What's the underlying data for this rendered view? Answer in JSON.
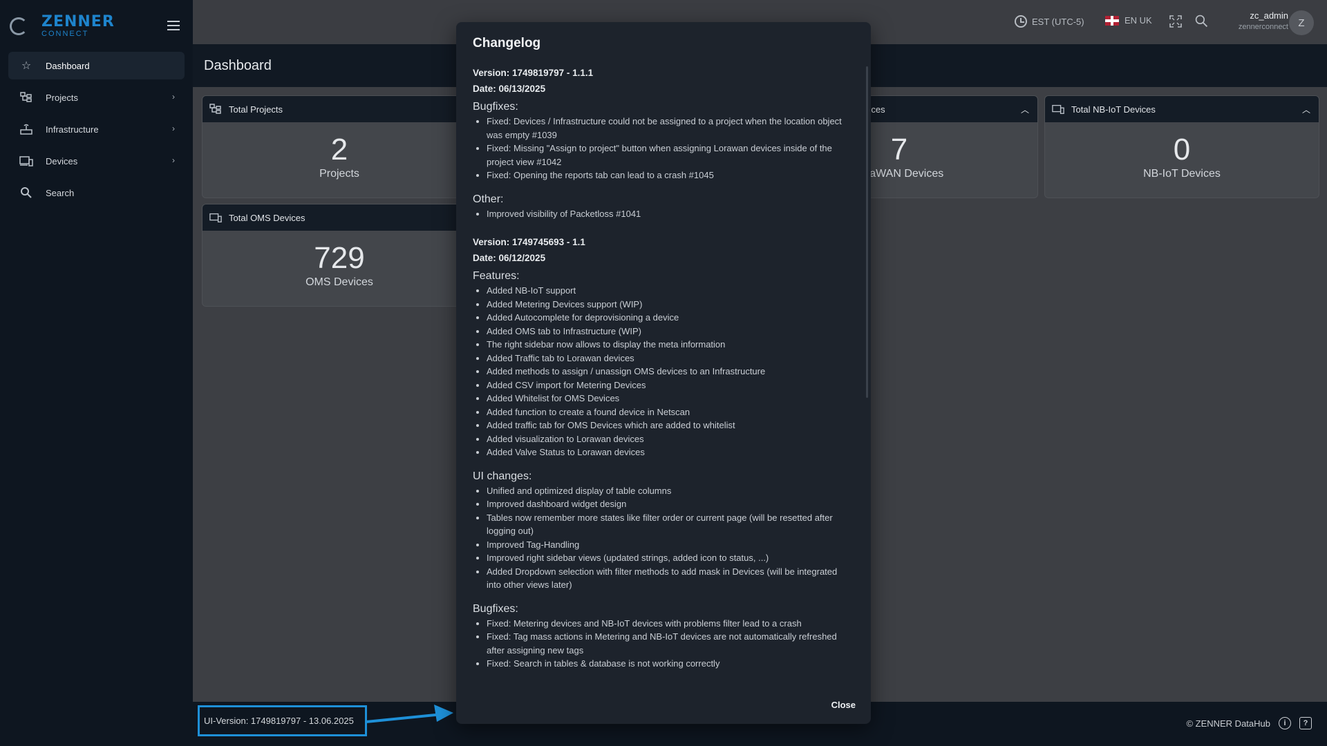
{
  "sidebar": {
    "brand_name": "ZENNER",
    "brand_sub": "CONNECT",
    "items": [
      {
        "label": "Dashboard",
        "icon": "star-icon"
      },
      {
        "label": "Projects",
        "icon": "projects-icon"
      },
      {
        "label": "Infrastructure",
        "icon": "router-icon"
      },
      {
        "label": "Devices",
        "icon": "devices-icon"
      },
      {
        "label": "Search",
        "icon": "search-icon"
      }
    ]
  },
  "topbar": {
    "timezone": "EST (UTC-5)",
    "language": "EN UK",
    "username": "zc_admin",
    "org": "zennerconnect",
    "avatar_initial": "Z"
  },
  "page": {
    "title": "Dashboard"
  },
  "widgets": [
    {
      "title": "Total Projects",
      "value": "2",
      "label": "Projects"
    },
    {
      "title": "vices",
      "value": "7",
      "label": "RaWAN Devices"
    },
    {
      "title": "Total NB-IoT Devices",
      "value": "0",
      "label": "NB-IoT Devices"
    },
    {
      "title": "Total OMS Devices",
      "value": "729",
      "label": "OMS Devices"
    }
  ],
  "footer": {
    "ui_version": "UI-Version: 1749819797 - 13.06.2025",
    "copyright": "© ZENNER DataHub"
  },
  "modal": {
    "title": "Changelog",
    "close_label": "Close",
    "v1": {
      "version": "Version: 1749819797 - 1.1.1",
      "date": "Date: 06/13/2025",
      "bugfixes_title": "Bugfixes:",
      "bugfixes": [
        "Fixed: Devices / Infrastructure could not be assigned to a project when the location object was empty #1039",
        "Fixed: Missing \"Assign to project\" button when assigning Lorawan devices inside of the project view #1042",
        "Fixed: Opening the reports tab can lead to a crash #1045"
      ],
      "other_title": "Other:",
      "other": [
        "Improved visibility of Packetloss #1041"
      ]
    },
    "v2": {
      "version": "Version: 1749745693 - 1.1",
      "date": "Date: 06/12/2025",
      "features_title": "Features:",
      "features": [
        "Added NB-IoT support",
        "Added Metering Devices support (WIP)",
        "Added Autocomplete for deprovisioning a device",
        "Added OMS tab to Infrastructure (WIP)",
        "The right sidebar now allows to display the meta information",
        "Added Traffic tab to Lorawan devices",
        "Added methods to assign / unassign OMS devices to an Infrastructure",
        "Added CSV import for Metering Devices",
        "Added Whitelist for OMS Devices",
        "Added function to create a found device in Netscan",
        "Added traffic tab for OMS Devices which are added to whitelist",
        "Added visualization to Lorawan devices",
        "Added Valve Status to Lorawan devices"
      ],
      "ui_title": "UI changes:",
      "ui_changes": [
        "Unified and optimized display of table columns",
        "Improved dashboard widget design",
        "Tables now remember more states like filter order or current page (will be resetted after logging out)",
        "Improved Tag-Handling",
        "Improved right sidebar views (updated strings, added icon to status, ...)",
        "Added Dropdown selection with filter methods to add mask in Devices (will be integrated into other views later)"
      ],
      "bugfixes_title": "Bugfixes:",
      "bugfixes": [
        "Fixed: Metering devices and NB-IoT devices with problems filter lead to a crash",
        "Fixed: Tag mass actions in Metering and NB-IoT devices are not automatically refreshed after assigning new tags",
        "Fixed: Search in tables & database is not working correctly"
      ]
    }
  }
}
